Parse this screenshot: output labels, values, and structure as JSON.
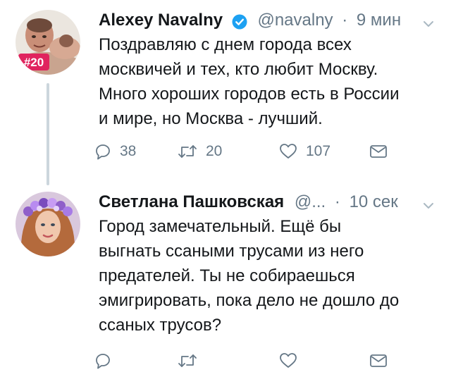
{
  "tweets": [
    {
      "author": {
        "name": "Alexey Navalny",
        "handle": "@navalny",
        "verified": true,
        "avatar_badge": "#20"
      },
      "separator": "·",
      "time": "9 мин",
      "text": "Поздравляю с днем города всех\nмосквичей и тех, кто любит Москву.\nМного хороших городов есть в России\nи мире, но Москва - лучший.",
      "actions": {
        "reply_count": "38",
        "retweet_count": "20",
        "like_count": "107"
      }
    },
    {
      "author": {
        "name": "Светлана Пашковская",
        "handle": "@..."
      },
      "separator": "·",
      "time": "10 сек",
      "text": "Город замечательный. Ещё бы\nвыгнать ссаными трусами из него\nпредателей. Ты не собираешься\nэмигрировать, пока дело не дошло до\nссаных трусов?"
    }
  ],
  "colors": {
    "text": "#14171a",
    "secondary": "#657786",
    "verified": "#1da1f2",
    "thread_line": "#ccd6dd",
    "badge": "#e0245e"
  },
  "icons": [
    "verified-badge-icon",
    "chevron-down-icon",
    "reply-icon",
    "retweet-icon",
    "like-icon",
    "direct-message-icon"
  ]
}
